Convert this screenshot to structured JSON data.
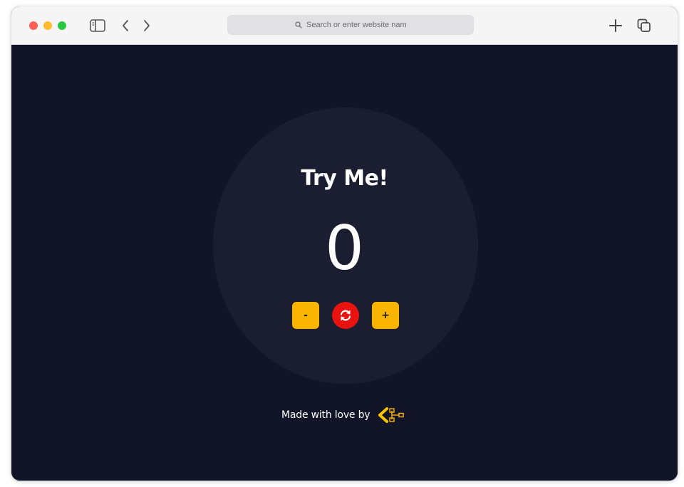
{
  "colors": {
    "traffic_red": "#fe5f57",
    "traffic_yellow": "#febc2e",
    "traffic_green": "#28c840",
    "page_background": "#111527",
    "card_background": "#1b1e30",
    "accent_yellow": "#f9b400",
    "reset_red": "#e8120e",
    "text": "#ffffff"
  },
  "toolbar": {
    "sidebar_icon": "sidebar-icon",
    "back_icon": "chevron-left-icon",
    "forward_icon": "chevron-right-icon",
    "new_tab_icon": "plus-icon",
    "tabs_icon": "tabs-overview-icon"
  },
  "address_bar": {
    "icon": "search-icon",
    "placeholder": "Search or enter website name",
    "value": ""
  },
  "counter_app": {
    "title": "Try Me!",
    "count": "0",
    "decrement_label": "-",
    "increment_label": "+",
    "reset_icon": "refresh-icon"
  },
  "footer": {
    "text": "Made with love by",
    "logo_icon": "brand-logo-icon"
  }
}
